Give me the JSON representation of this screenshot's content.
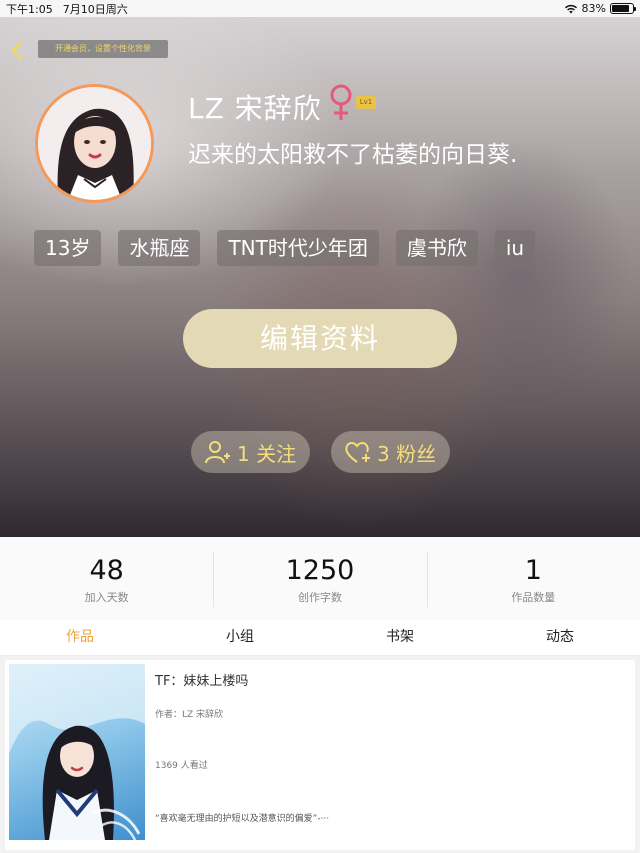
{
  "status_bar": {
    "time": "下午1:05",
    "date": "7月10日周六",
    "battery": "83%",
    "battery_level": 0.83
  },
  "header": {
    "vip_banner": "开通会员，设置个性化背景"
  },
  "profile": {
    "nickname": "LZ 宋辞欣",
    "gender": "female",
    "gender_icon": "female-symbol-icon",
    "gender_color": "#e8587a",
    "level": "Lv1",
    "signature": "迟来的太阳救不了枯萎的向日葵.",
    "tags": [
      "13岁",
      "水瓶座",
      "TNT时代少年团",
      "虞书欣",
      "iu"
    ],
    "edit_button": "编辑资料",
    "following_label": "1 关注",
    "followers_label": "3 粉丝"
  },
  "stats": [
    {
      "value": "48",
      "label": "加入天数"
    },
    {
      "value": "1250",
      "label": "创作字数"
    },
    {
      "value": "1",
      "label": "作品数量"
    }
  ],
  "tabs": [
    {
      "label": "作品",
      "active": true
    },
    {
      "label": "小组",
      "active": false
    },
    {
      "label": "书架",
      "active": false
    },
    {
      "label": "动态",
      "active": false
    }
  ],
  "works": [
    {
      "title": "TF：妹妹上楼吗",
      "author": "作者：LZ 宋辞欣",
      "views": "1369 人看过",
      "description": "“喜欢毫无理由的护短以及潜意识的偏爱”-···"
    }
  ],
  "colors": {
    "accent": "#f0a23a",
    "edit_button_bg": "#e3d9b4",
    "follow_text": "#f5de7a",
    "avatar_border": "#f39a5a"
  }
}
